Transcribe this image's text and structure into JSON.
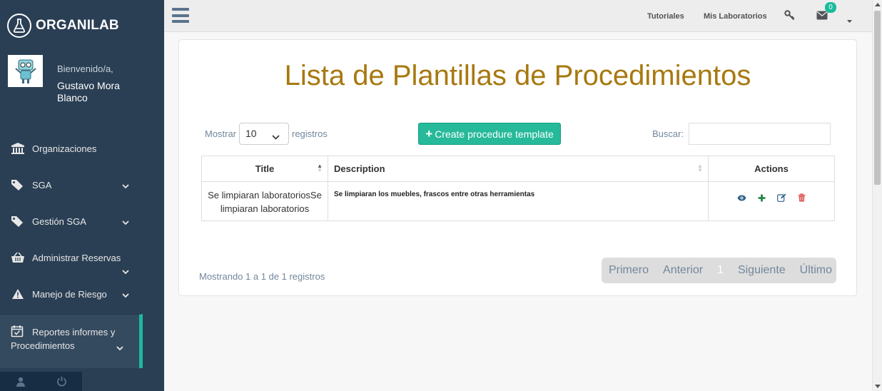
{
  "brand": {
    "name": "ORGANILAB"
  },
  "user": {
    "welcome": "Bienvenido/a,",
    "name": "Gustavo Mora Blanco"
  },
  "sidebar": {
    "items": [
      {
        "label": "Organizaciones",
        "icon": "bank-icon"
      },
      {
        "label": "SGA",
        "icon": "tags-icon"
      },
      {
        "label": "Gestión SGA",
        "icon": "tags-icon"
      },
      {
        "label": "Administrar Reservas",
        "icon": "basket-icon"
      },
      {
        "label": "Manejo de Riesgo",
        "icon": "warning-icon"
      },
      {
        "label": "Reportes informes y Procedimientos",
        "icon": "calendar-check-icon"
      }
    ]
  },
  "topnav": {
    "tutorials": "Tutoriales",
    "my_labs": "Mis Laboratorios",
    "messages_count": "0"
  },
  "page": {
    "title": "Lista de Plantillas de Procedimientos",
    "show_label": "Mostrar",
    "show_value": "10",
    "records_label": "registros",
    "create_button": "Create procedure template",
    "search_label": "Buscar:",
    "search_value": "",
    "table": {
      "headers": {
        "title": "Title",
        "description": "Description",
        "actions": "Actions"
      },
      "rows": [
        {
          "title": "Se limpiaran laboratoriosSe limpiaran laboratorios",
          "description": "Se limpiaran los muebles, frascos entre otras herramientas"
        }
      ]
    },
    "info": "Mostrando 1 a 1 de 1 registros",
    "pager": {
      "first": "Primero",
      "prev": "Anterior",
      "current": "1",
      "next": "Siguiente",
      "last": "Último"
    }
  },
  "colors": {
    "sidebar": "#2a3f54",
    "accent": "#1abb9c",
    "title": "#a7790f",
    "button": "#26b99a",
    "danger": "#d9534f"
  }
}
